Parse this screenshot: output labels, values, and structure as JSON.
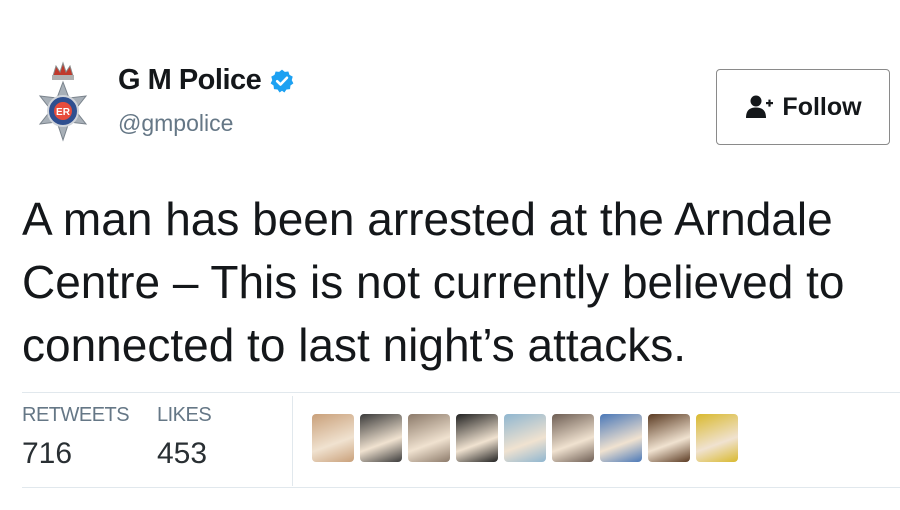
{
  "tweet": {
    "name": "G M Police",
    "handle": "@gmpolice",
    "verified": true,
    "follow_label": "Follow",
    "text": "A man has been arrested at the Arndale Centre – This is not currently believed to connected to last night’s attacks.",
    "stats": {
      "retweets_label": "RETWEETS",
      "retweets": "716",
      "likes_label": "LIKES",
      "likes": "453"
    },
    "likers": [
      {
        "icon": "liker-avatar-1",
        "color": "#c9a07a"
      },
      {
        "icon": "liker-avatar-2",
        "color": "#3a3a3a"
      },
      {
        "icon": "liker-avatar-3",
        "color": "#8c7a6a"
      },
      {
        "icon": "liker-avatar-4",
        "color": "#222222"
      },
      {
        "icon": "liker-avatar-5",
        "color": "#8fb6d0"
      },
      {
        "icon": "liker-avatar-6",
        "color": "#6e5e54"
      },
      {
        "icon": "liker-avatar-7",
        "color": "#4a78b8"
      },
      {
        "icon": "liker-avatar-8",
        "color": "#5b3b23"
      },
      {
        "icon": "liker-avatar-9",
        "color": "#d9b92e"
      }
    ]
  },
  "colors": {
    "verified_blue": "#1da1f2",
    "text": "#14171a",
    "muted": "#657786"
  }
}
